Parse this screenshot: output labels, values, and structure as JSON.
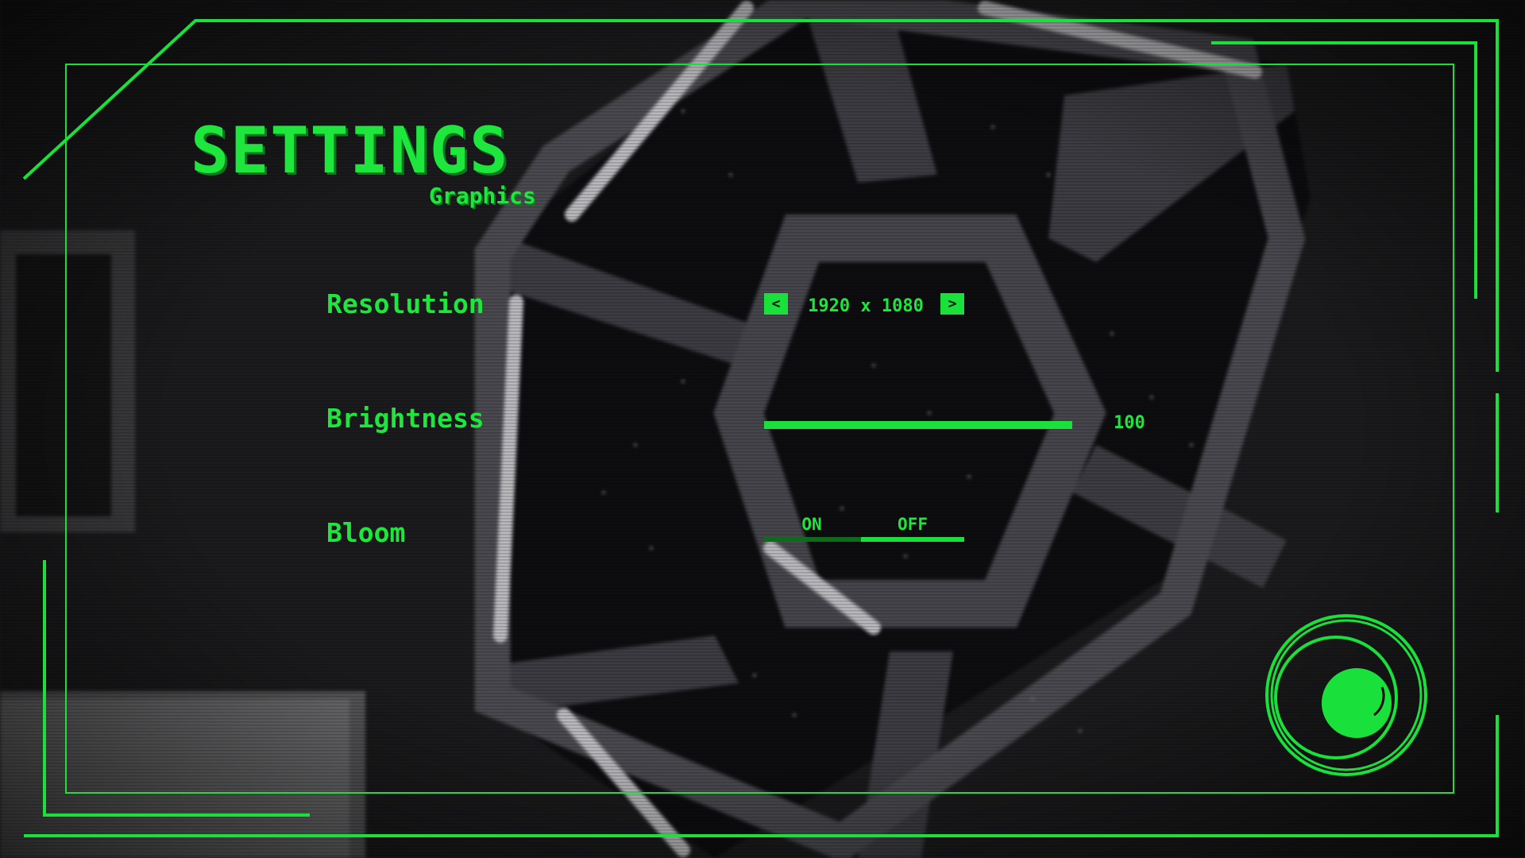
{
  "screen": {
    "title": "SETTINGS",
    "subtitle": "Graphics"
  },
  "settings": {
    "resolution": {
      "label": "Resolution",
      "value": "1920 x 1080",
      "prev_icon": "<",
      "next_icon": ">"
    },
    "brightness": {
      "label": "Brightness",
      "value": "100",
      "level": 1.0
    },
    "bloom": {
      "label": "Bloom",
      "options": [
        "ON",
        "OFF"
      ],
      "selected": "OFF"
    }
  },
  "colors": {
    "accent": "#19e03a",
    "accent_dark": "#0c7a1e"
  },
  "icons": {
    "back": "circle-emblem-icon"
  }
}
